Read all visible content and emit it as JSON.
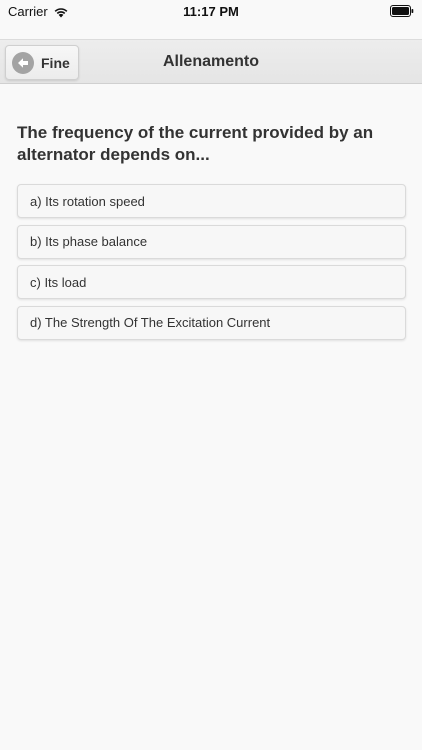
{
  "status_bar": {
    "carrier": "Carrier",
    "time": "11:17 PM"
  },
  "header": {
    "back_label": "Fine",
    "title": "Allenamento"
  },
  "quiz": {
    "question": "The frequency of the current provided by an alternator depends on...",
    "answers": [
      {
        "label": "a) Its rotation speed"
      },
      {
        "label": "b) Its phase balance"
      },
      {
        "label": "c) Its load"
      },
      {
        "label": "d) The Strength Of The Excitation Current"
      }
    ]
  },
  "icons": {
    "wifi": "wifi-icon",
    "battery": "battery-icon",
    "back": "arrow-left-circle-icon"
  },
  "colors": {
    "background": "#f9f9f9",
    "header": "#e8e8e8",
    "text": "#333333",
    "back_icon": "#a3a3a3"
  }
}
